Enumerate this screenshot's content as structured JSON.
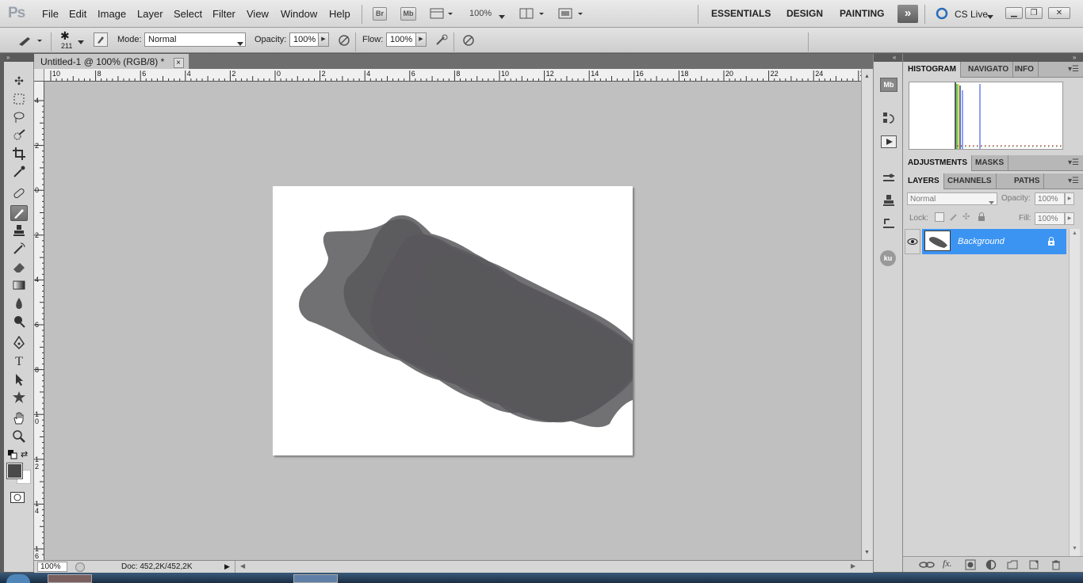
{
  "app": {
    "logo": "Ps"
  },
  "menubar": {
    "items": [
      "File",
      "Edit",
      "Image",
      "Layer",
      "Select",
      "Filter",
      "View",
      "Window",
      "Help"
    ],
    "bridge": "Br",
    "minibridge": "Mb",
    "zoom": "100%",
    "workspaces": [
      "ESSENTIALS",
      "DESIGN",
      "PAINTING"
    ],
    "more": "»",
    "cslive": "CS Live"
  },
  "options": {
    "brush_size": "211",
    "mode_label": "Mode:",
    "mode_value": "Normal",
    "opacity_label": "Opacity:",
    "opacity_value": "100%",
    "flow_label": "Flow:",
    "flow_value": "100%"
  },
  "document": {
    "tab_title": "Untitled-1 @ 100% (RGB/8) *",
    "close": "×",
    "ruler_top": [
      "10",
      "8",
      "6",
      "4",
      "2",
      "0",
      "2",
      "4",
      "6",
      "8",
      "10",
      "12",
      "14",
      "16",
      "18",
      "20",
      "22",
      "24",
      "2"
    ],
    "ruler_left": [
      "4",
      "2",
      "0",
      "2",
      "4",
      "6",
      "8",
      "1 0",
      "1 2",
      "1 4",
      "1 6"
    ]
  },
  "status": {
    "zoom": "100%",
    "info": "Doc: 452,2K/452,2K"
  },
  "panels": {
    "top_tabs": [
      "HISTOGRAM",
      "NAVIGATO",
      "INFO"
    ],
    "mid_tabs": [
      "ADJUSTMENTS",
      "MASKS"
    ],
    "layer_tabs": [
      "LAYERS",
      "CHANNELS",
      "PATHS"
    ],
    "blend_mode": "Normal",
    "opacity_label": "Opacity:",
    "opacity_value": "100%",
    "lock_label": "Lock:",
    "fill_label": "Fill:",
    "fill_value": "100%",
    "layer_name": "Background",
    "iconstrip_ku": "ku"
  },
  "colors": {
    "accent": "#3b94f2",
    "canvas_bg": "#c0c0c0",
    "foreground": "#4a4a4a",
    "shape": "#58575b"
  }
}
